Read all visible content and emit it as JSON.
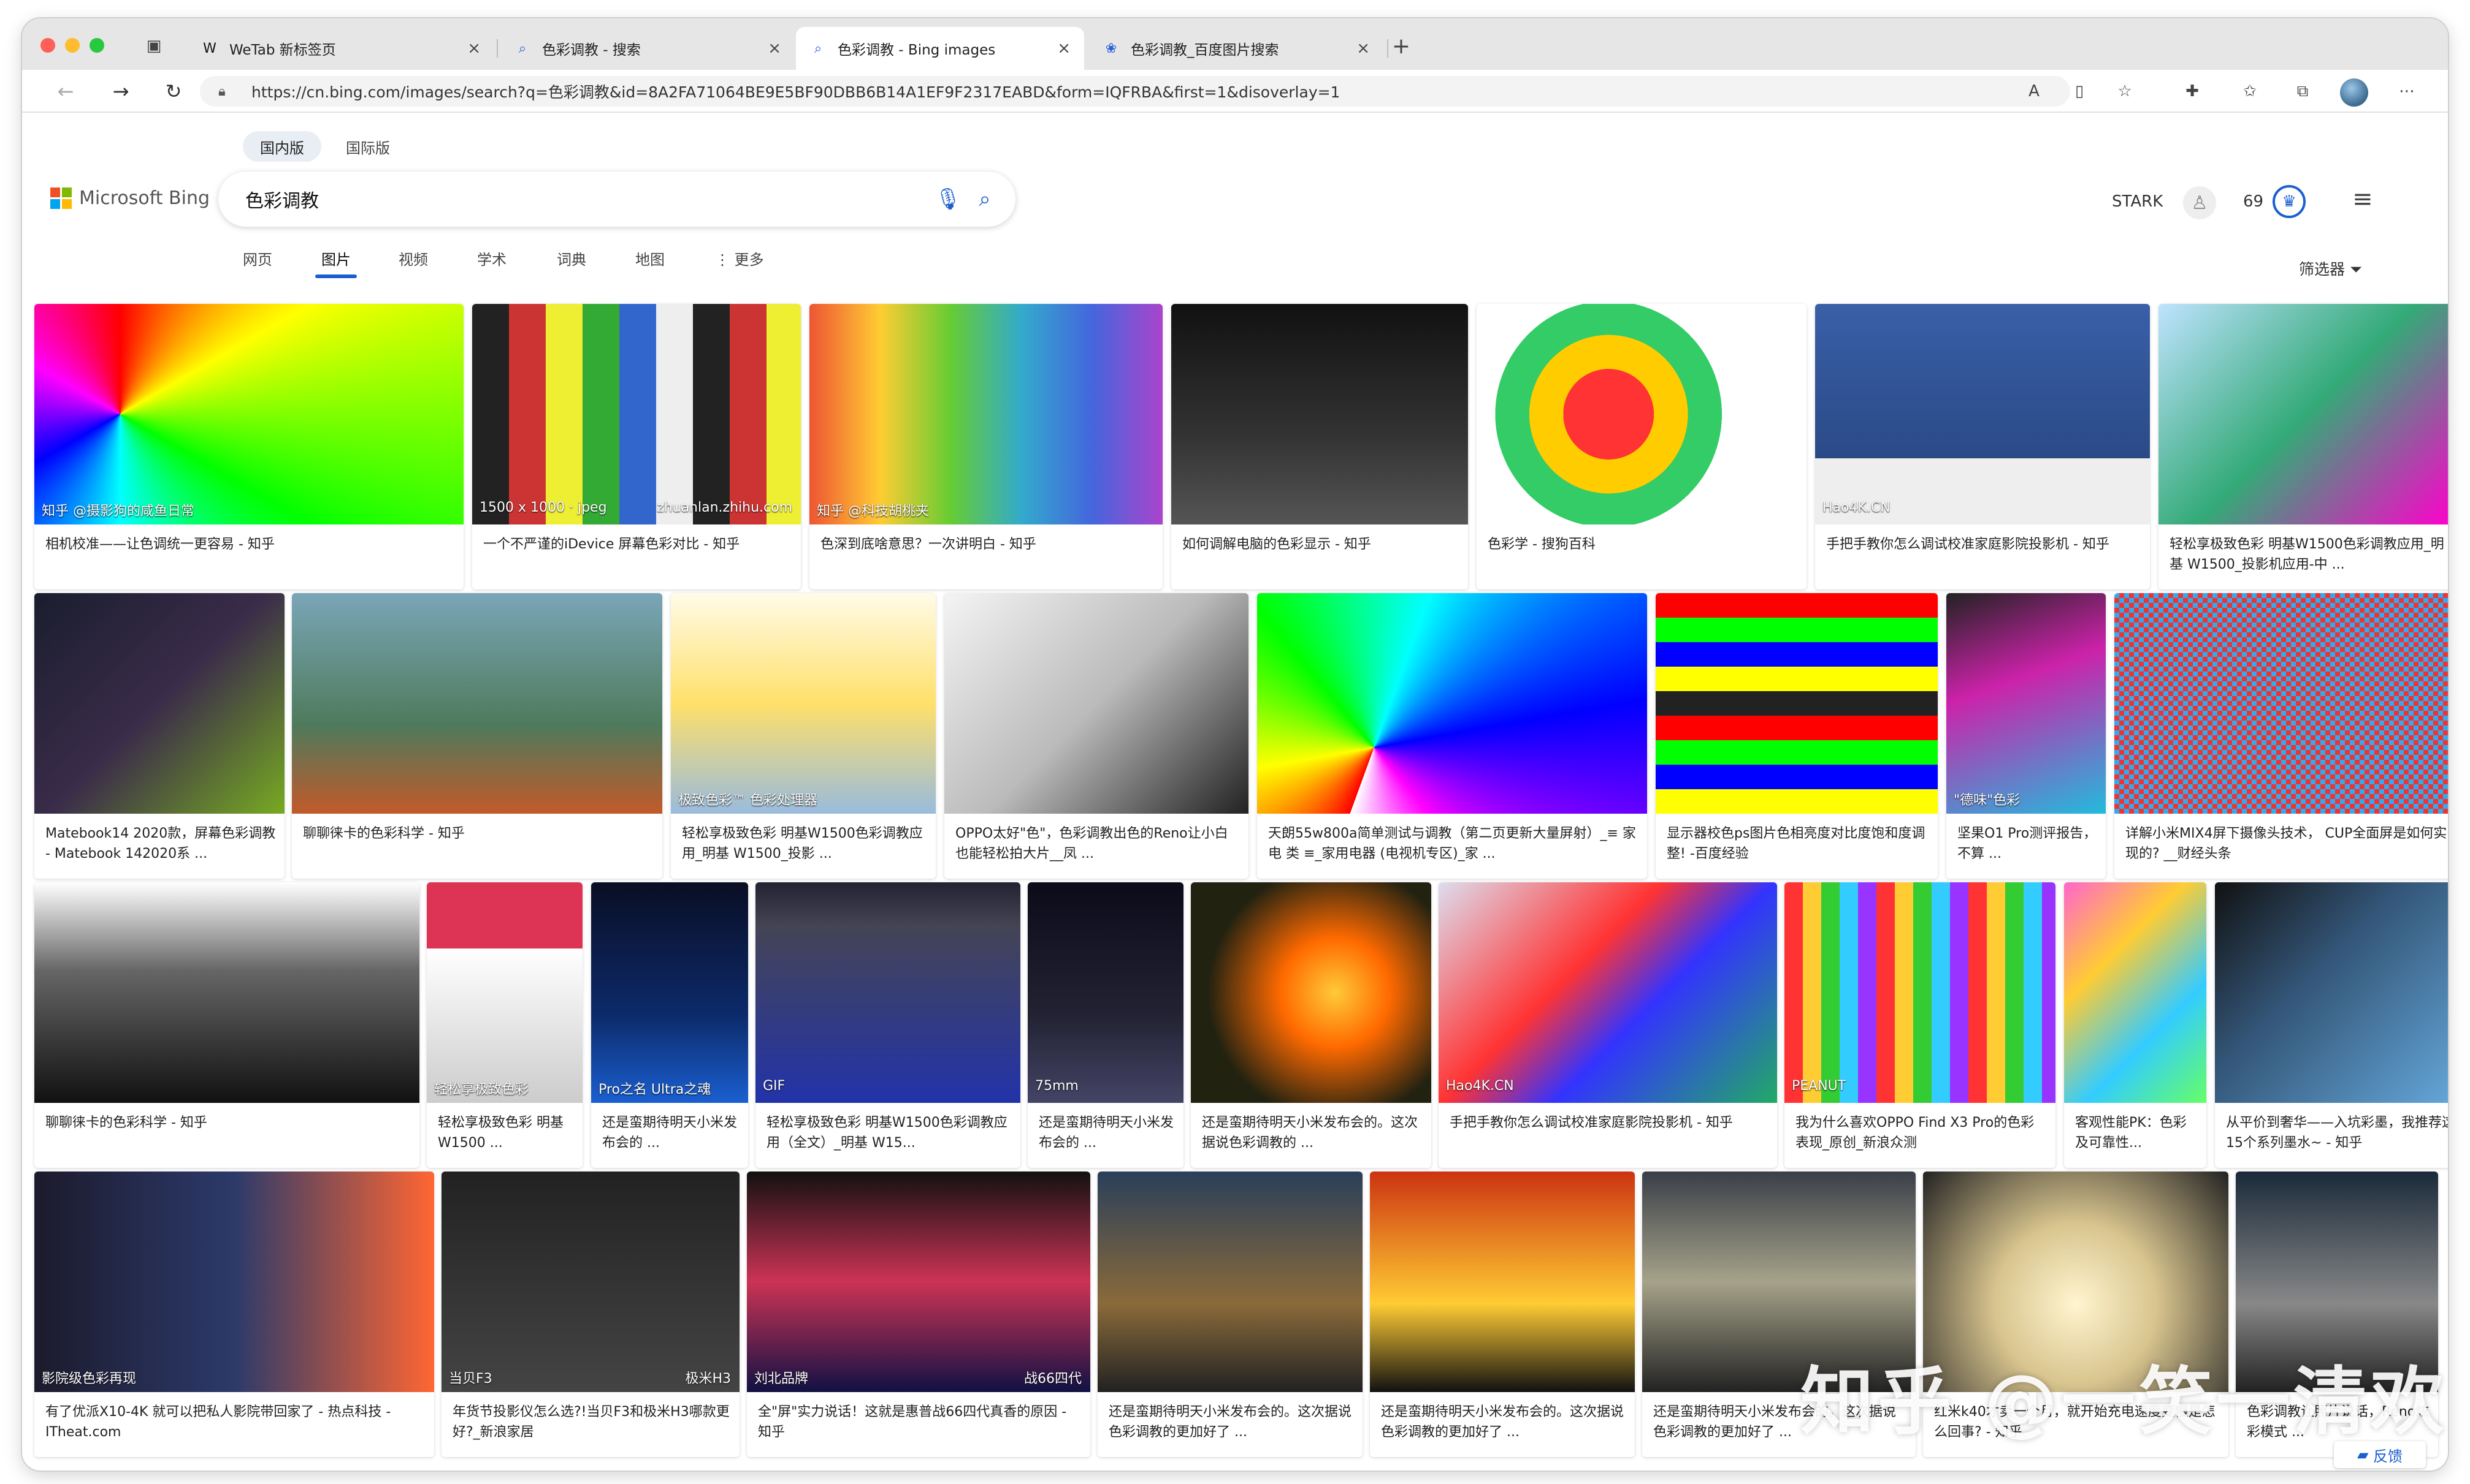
{
  "tabs": [
    {
      "label": "WeTab 新标签页",
      "icon": "wetab-icon"
    },
    {
      "label": "色彩调教 - 搜索",
      "icon": "search-icon"
    },
    {
      "label": "色彩调教 - Bing images",
      "icon": "search-icon"
    },
    {
      "label": "色彩调教_百度图片搜索",
      "icon": "baidu-icon"
    }
  ],
  "address": {
    "url": "https://cn.bing.com/images/search?q=色彩调教&id=8A2FA71064BE9E5BF90DBB6B14A1EF9F2317EABD&form=IQFRBA&first=1&disoverlay=1"
  },
  "bing": {
    "scopes": [
      "国内版",
      "国际版"
    ],
    "logo_text": "Microsoft Bing",
    "query": "色彩调教",
    "verticals": [
      "网页",
      "图片",
      "视频",
      "学术",
      "词典",
      "地图",
      "⋮ 更多"
    ],
    "user": "STARK",
    "rewards": "69",
    "filter_label": "筛选器"
  },
  "results": [
    {
      "caption": "相机校准——让色调统一更容易 - 知乎",
      "overlay": "知乎 @摄影狗的咸鱼日常"
    },
    {
      "caption": "一个不严谨的iDevice 屏幕色彩对比 - 知乎",
      "overlay": "1500 x 1000 · jpeg",
      "overlay2": "zhuanlan.zhihu.com"
    },
    {
      "caption": "色深到底啥意思？一次讲明白 - 知乎",
      "overlay": "知乎 @科技胡桃夹"
    },
    {
      "caption": "如何调解电脑的色彩显示 - 知乎"
    },
    {
      "caption": "色彩学 - 搜狗百科"
    },
    {
      "caption": "手把手教你怎么调试校准家庭影院投影机 - 知乎",
      "overlay": "Hao4K.CN"
    },
    {
      "caption": "轻松享极致色彩 明基W1500色彩调教应用_明基 W1500_投影机应用-中 ..."
    },
    {
      "caption": "Matebook14 2020款，屏幕色彩调教 - Matebook 142020系 ..."
    },
    {
      "caption": "聊聊徕卡的色彩科学 - 知乎"
    },
    {
      "caption": "轻松享极致色彩 明基W1500色彩调教应用_明基 W1500_投影 ...",
      "overlay": "极致色彩™ 色彩处理器"
    },
    {
      "caption": "OPPO太好\"色\"，色彩调教出色的Reno让小白也能轻松拍大片__凤 ..."
    },
    {
      "caption": "天朗55w800a简单测试与调教（第二页更新大量屏射）_≡ 家 电 类 ≡_家用电器 (电视机专区)_家 ..."
    },
    {
      "caption": "显示器校色ps图片色相亮度对比度饱和度调整! -百度经验"
    },
    {
      "caption": "坚果O1 Pro测评报告，不算 ...",
      "overlay": "\"德味\"色彩"
    },
    {
      "caption": "详解小米MIX4屏下摄像头技术， CUP全面屏是如何实现的? __财经头条"
    },
    {
      "caption": "聊聊徕卡的色彩科学 - 知乎"
    },
    {
      "caption": "轻松享极致色彩 明基W1500 ...",
      "overlay": "轻松享极致色彩"
    },
    {
      "caption": "还是蛮期待明天小米发布会的 ...",
      "overlay": "Pro之名 Ultra之魂"
    },
    {
      "caption": "轻松享极致色彩 明基W1500色彩调教应用（全文）_明基 W15...",
      "overlay": "GIF"
    },
    {
      "caption": "还是蛮期待明天小米发布会的 ...",
      "overlay": "75mm"
    },
    {
      "caption": "还是蛮期待明天小米发布会的。这次据说色彩调教的 ..."
    },
    {
      "caption": "手把手教你怎么调试校准家庭影院投影机 - 知乎",
      "overlay": "Hao4K.CN"
    },
    {
      "caption": "我为什么喜欢OPPO Find X3 Pro的色彩表现_原创_新浪众测",
      "overlay": "PEANUT"
    },
    {
      "caption": "客观性能PK：色彩及可靠性..."
    },
    {
      "caption": "从平价到奢华——入坑彩墨，我推荐这15个系列墨水~ - 知乎"
    },
    {
      "caption": "有了优派X10-4K 就可以把私人影院带回家了 - 热点科技 - ITheat.com",
      "overlay": "影院级色彩再现"
    },
    {
      "caption": "年货节投影仪怎么选?!当贝F3和极米H3哪款更好?_新浪家居",
      "overlay": "当贝F3",
      "overlay2": "极米H3"
    },
    {
      "caption": "全\"屏\"实力说话！这就是惠普战66四代真香的原因 - 知乎",
      "overlay": "刘北品牌",
      "overlay2": "战66四代"
    },
    {
      "caption": "还是蛮期待明天小米发布会的。这次据说色彩调教的更加好了 ..."
    },
    {
      "caption": "还是蛮期待明天小米发布会的。这次据说色彩调教的更加好了 ..."
    },
    {
      "caption": "还是蛮期待明天小米发布会的。这次据说色彩调教的更加好了 ..."
    },
    {
      "caption": "红米k40才卖一个月，就开始充电速度变慢是怎么回事? - 知乎"
    },
    {
      "caption": "色彩调教让照片说话，Reno炫彩模式 ..."
    }
  ],
  "watermark": "知乎 @一笑一清欢",
  "feedback": "反馈"
}
